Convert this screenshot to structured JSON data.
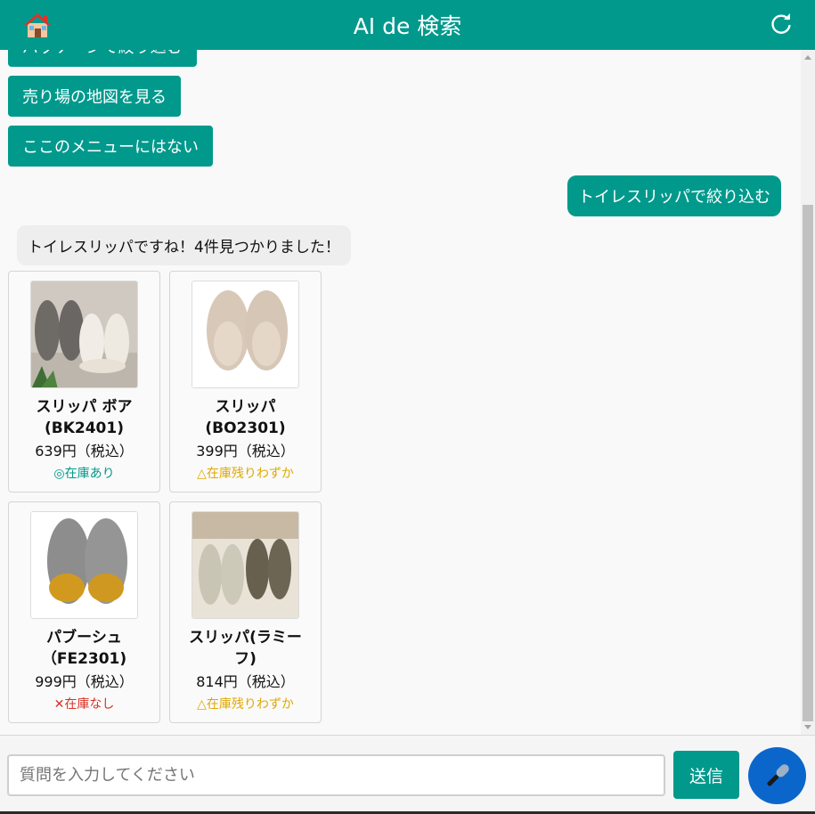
{
  "header": {
    "title": "AI de 検索",
    "home_icon": "home-icon",
    "refresh_icon": "refresh-icon",
    "color": "#00998c"
  },
  "chat": {
    "options": [
      "パッケージで絞り込む",
      "売り場の地図を見る",
      "ここのメニューにはない"
    ],
    "user_message": "トイレスリッパで絞り込む",
    "bot_message": "トイレスリッパですね！4件見つかりました！",
    "products": [
      {
        "name": "スリッパ ボア (BK2401)",
        "price": "639円（税込）",
        "stock": "◎在庫あり",
        "stock_color": "#00998c"
      },
      {
        "name": "スリッパ (BO2301)",
        "price": "399円（税込）",
        "stock": "△在庫残りわずか",
        "stock_color": "#e0a800"
      },
      {
        "name": "パブーシュ （FE2301)",
        "price": "999円（税込）",
        "stock": "✕在庫なし",
        "stock_color": "#d93025"
      },
      {
        "name": "スリッパ(ラミーフ)",
        "price": "814円（税込）",
        "stock": "△在庫残りわずか",
        "stock_color": "#e0a800"
      }
    ]
  },
  "footer": {
    "input_placeholder": "質問を入力してください",
    "input_value": "",
    "send_label": "送信",
    "mic_icon": "microphone-icon"
  }
}
